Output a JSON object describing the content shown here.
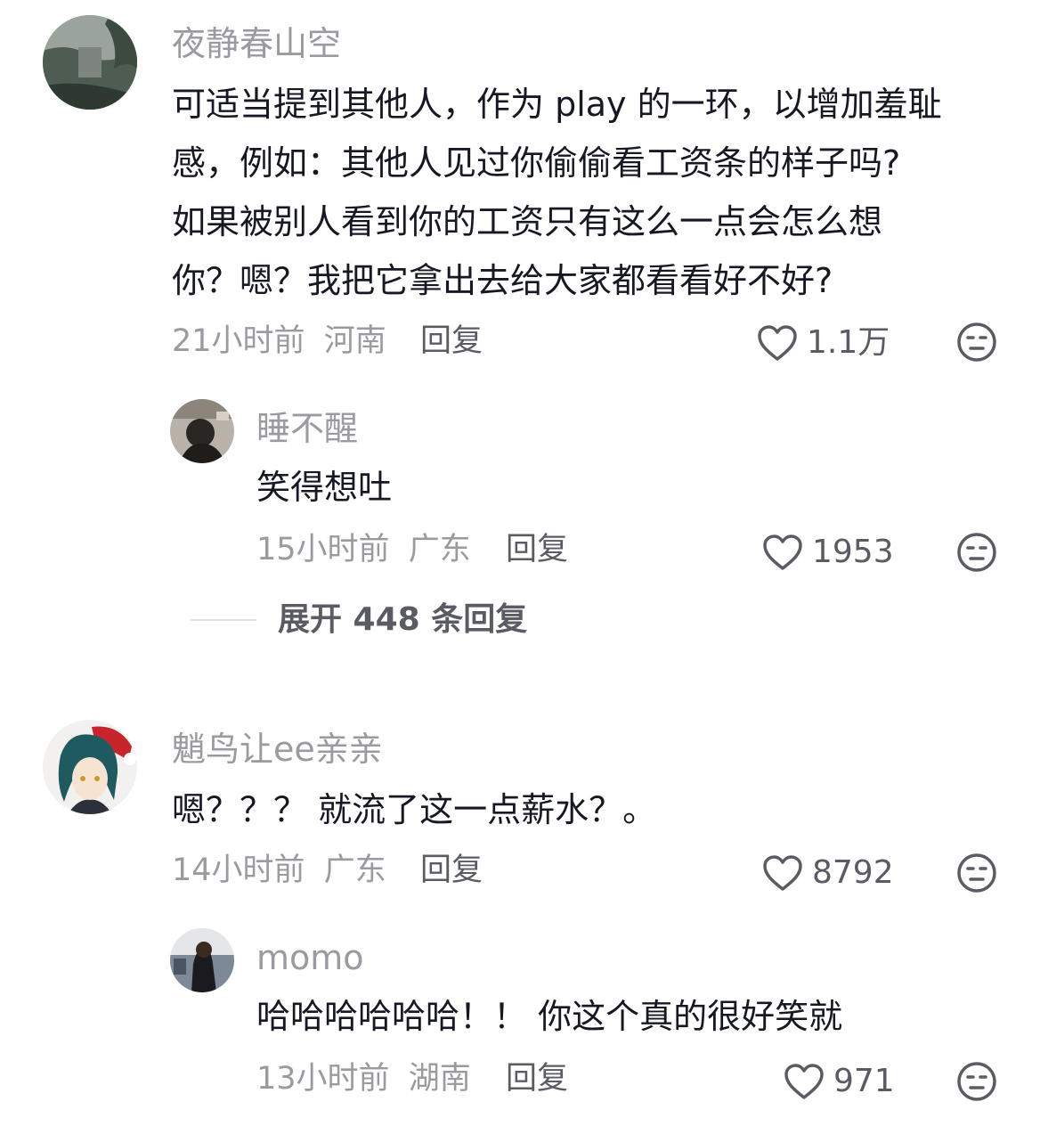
{
  "comments": [
    {
      "username": "夜静春山空",
      "lines": [
        "可适当提到其他人，作为 play 的一环，以增加羞耻",
        "感，例如：其他人见过你偷偷看工资条的样子吗?",
        "如果被别人看到你的工资只有这么一点会怎么想",
        "你？嗯？我把它拿出去给大家都看看好不好?"
      ],
      "time": "21小时前",
      "location": "河南",
      "reply_label": "回复",
      "likes": "1.1万",
      "replies": [
        {
          "username": "睡不醒",
          "text": "笑得想吐",
          "time": "15小时前",
          "location": "广东",
          "reply_label": "回复",
          "likes": "1953"
        }
      ],
      "expand_label": "展开 448 条回复"
    },
    {
      "username": "魈鸟让ee亲亲",
      "lines": [
        "嗯？？？ 就流了这一点薪水？。"
      ],
      "time": "14小时前",
      "location": "广东",
      "reply_label": "回复",
      "likes": "8792",
      "replies": [
        {
          "username": "momo",
          "text": "哈哈哈哈哈哈！！ 你这个真的很好笑就",
          "time": "13小时前",
          "location": "湖南",
          "reply_label": "回复",
          "likes": "971"
        }
      ]
    }
  ],
  "icons": {
    "like": "heart-outline-icon",
    "dislike": "neutral-face-icon"
  },
  "colors": {
    "username": "#9a9ba1",
    "text": "#161823",
    "secondary": "#5b5c63",
    "divider": "#e3e3e5"
  }
}
